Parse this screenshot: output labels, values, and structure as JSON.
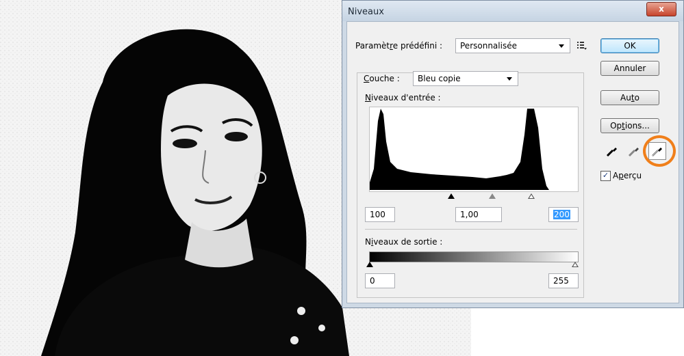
{
  "dialog": {
    "title": "Niveaux",
    "close_glyph": "x"
  },
  "preset": {
    "label_before": "Paramèt",
    "label_under": "r",
    "label_after": "e prédéfini :",
    "value": "Personnalisée",
    "menu_icon": "preset-options-icon"
  },
  "channel": {
    "label_under": "C",
    "label_after": "ouche :",
    "value": "Bleu copie"
  },
  "input_levels": {
    "label_under": "N",
    "label_after": "iveaux d'entrée :",
    "black": "100",
    "gamma": "1,00",
    "white": "200"
  },
  "output_levels": {
    "label_before": "N",
    "label_under": "i",
    "label_after": "veaux de sortie :",
    "black": "0",
    "white": "255"
  },
  "buttons": {
    "ok": "OK",
    "cancel": "Annuler",
    "auto_before": "Au",
    "auto_under": "t",
    "auto_after": "o",
    "options_before": "Op",
    "options_under": "t",
    "options_after": "ions..."
  },
  "eyedroppers": {
    "black": "black-point-eyedropper-icon",
    "gray": "gray-point-eyedropper-icon",
    "white": "white-point-eyedropper-icon",
    "highlight_color": "#f07f1a"
  },
  "preview": {
    "checked": true,
    "label_before": "A",
    "label_under": "p",
    "label_after": "erçu"
  }
}
